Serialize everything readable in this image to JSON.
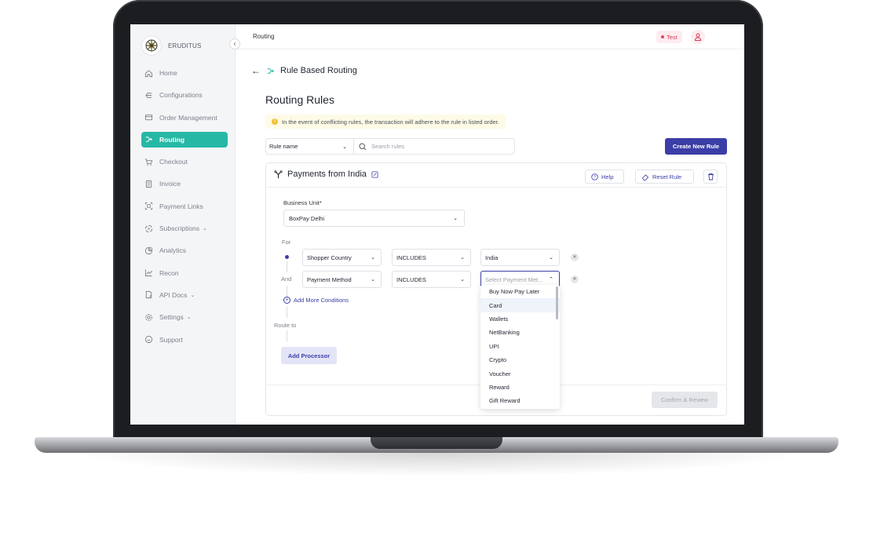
{
  "sidebar": {
    "brand": "ERUDITUS",
    "collapse_icon": "‹",
    "items": [
      {
        "label": "Home",
        "icon": "home-icon"
      },
      {
        "label": "Configurations",
        "icon": "configurations-icon"
      },
      {
        "label": "Order Management",
        "icon": "order-management-icon"
      },
      {
        "label": "Routing",
        "icon": "routing-icon",
        "active": true
      },
      {
        "label": "Checkout",
        "icon": "cart-icon"
      },
      {
        "label": "Invoice",
        "icon": "invoice-icon"
      },
      {
        "label": "Payment Links",
        "icon": "payment-links-icon"
      },
      {
        "label": "Subscriptions",
        "icon": "subscriptions-icon",
        "expandable": true
      },
      {
        "label": "Analytics",
        "icon": "analytics-icon"
      },
      {
        "label": "Recon",
        "icon": "recon-icon"
      },
      {
        "label": "API Docs",
        "icon": "api-docs-icon",
        "expandable": true
      },
      {
        "label": "Settings",
        "icon": "settings-icon",
        "expandable": true
      },
      {
        "label": "Support",
        "icon": "support-icon"
      }
    ]
  },
  "topbar": {
    "title": "Routing",
    "env_badge": "Test"
  },
  "header": {
    "back_title": "Rule Based Routing"
  },
  "page": {
    "title": "Routing Rules",
    "info_text": "In the event of conflicting rules, the transaction will adhere to the rule in listed order.",
    "filter_label": "Rule name",
    "search_placeholder": "Search rules",
    "create_button": "Create New Rule"
  },
  "rule": {
    "title": "Payments from India",
    "help_label": "Help",
    "reset_label": "Reset Rule",
    "business_unit_label": "Business Unit*",
    "business_unit_value": "BoxPay Delhi",
    "for_label": "For",
    "and_label": "And",
    "route_label": "Route to",
    "conditions": [
      {
        "field": "Shopper Country",
        "operator": "INCLUDES",
        "value": "India",
        "value_placeholder": ""
      },
      {
        "field": "Payment Method",
        "operator": "INCLUDES",
        "value": "",
        "value_placeholder": "Select Payment Met..."
      }
    ],
    "add_condition_label": "Add More Conditions",
    "add_processor_label": "Add Processor",
    "confirm_label": "Confirm & Review"
  },
  "dropdown": {
    "options": [
      "Buy Now Pay Later",
      "Card",
      "Wallets",
      "NetBanking",
      "UPI",
      "Crypto",
      "Voucher",
      "Reward",
      "Gift Reward"
    ],
    "hovered_index": 1
  },
  "colors": {
    "accent": "#3b3ea6",
    "active_nav": "#26b8a5",
    "warning_bg": "#fdfbe6",
    "badge_bg": "#fdecef"
  }
}
